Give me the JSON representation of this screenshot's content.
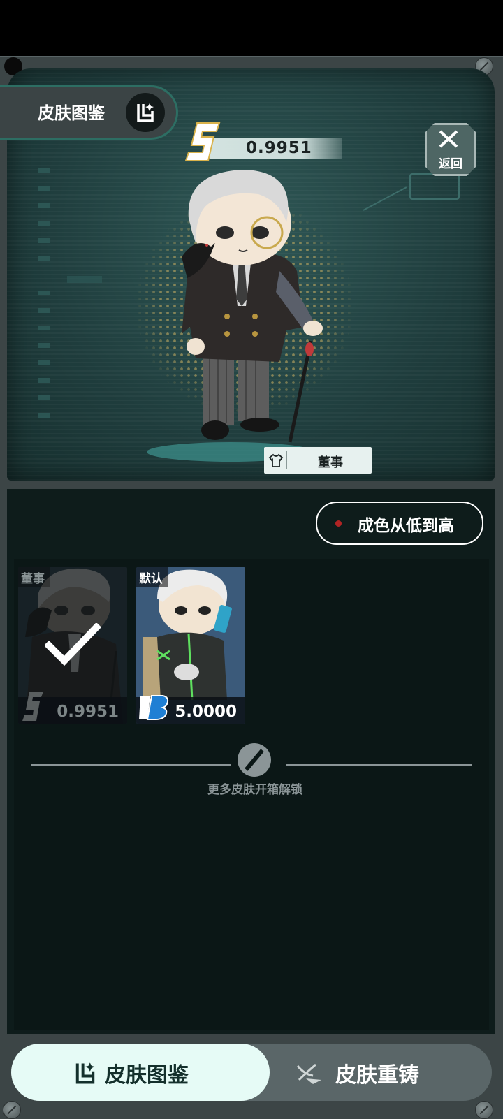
{
  "header": {
    "title": "皮肤图鉴",
    "back_label": "返回"
  },
  "current_skin": {
    "value": "0.9951",
    "name": "董事",
    "tag_icon": "shirt-icon"
  },
  "sort": {
    "label": "成色从低到高",
    "dot_color": "#b02424"
  },
  "skins": [
    {
      "name": "董事",
      "value": "0.9951",
      "currency": "S",
      "selected": true
    },
    {
      "name": "默认",
      "value": "5.0000",
      "currency": "B",
      "selected": false
    }
  ],
  "more_hint": "更多皮肤开箱解锁",
  "tabs": [
    {
      "label": "皮肤图鉴",
      "icon": "catalog-icon",
      "active": true
    },
    {
      "label": "皮肤重铸",
      "icon": "recast-icon",
      "active": false
    }
  ],
  "colors": {
    "accent": "#2d6e63",
    "active_tab": "#e6fbf6",
    "panel": "#1f3d3d"
  }
}
